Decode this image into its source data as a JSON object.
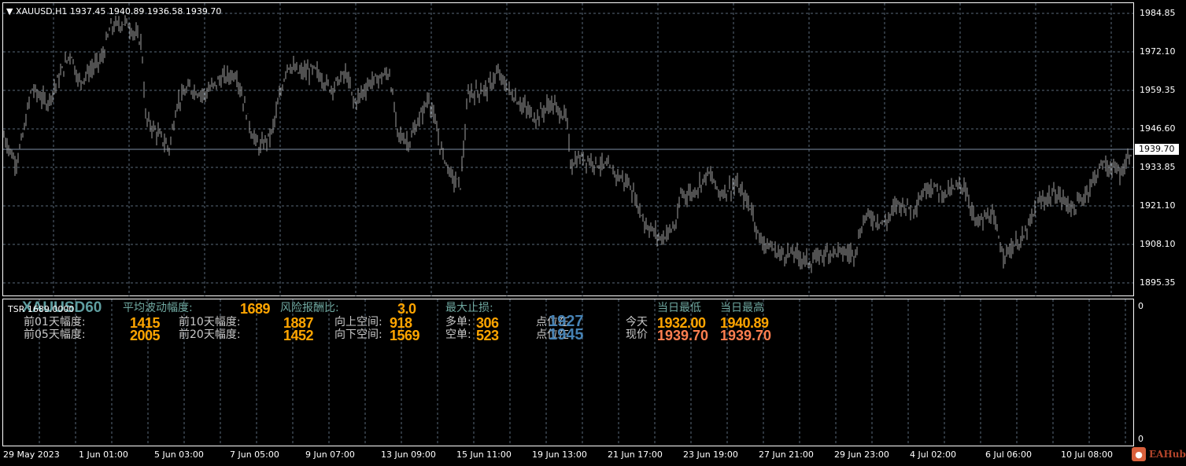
{
  "header": {
    "symbol": "XAUUSD,H1",
    "open": "1937.45",
    "high": "1940.89",
    "low": "1936.58",
    "close": "1939.70"
  },
  "price_axis": [
    "1984.85",
    "1972.10",
    "1959.35",
    "1946.60",
    "1933.85",
    "1921.10",
    "1908.10",
    "1895.35"
  ],
  "current_price": "1939.70",
  "time_axis": [
    "29 May 2023",
    "1 Jun 01:00",
    "5 Jun 03:00",
    "7 Jun 05:00",
    "9 Jun 07:00",
    "13 Jun 09:00",
    "15 Jun 11:00",
    "19 Jun 13:00",
    "21 Jun 17:00",
    "23 Jun 19:00",
    "27 Jun 21:00",
    "29 Jun 23:00",
    "4 Jul 02:00",
    "6 Jul 06:00",
    "10 Jul 08:00"
  ],
  "indicator": {
    "name": "TSR 1689.0000",
    "symbol_tag": "XAUUSD60",
    "axis_top": "0",
    "axis_bottom": "0",
    "avg_range_label": "平均波动幅度:",
    "avg_range": "1689",
    "rr_label": "风险报酬比:",
    "rr": "3.0",
    "max_sl_label": "最大止损:",
    "d1_label": "前01天幅度:",
    "d1": "1415",
    "d5_label": "前05天幅度:",
    "d5": "2005",
    "d10_label": "前10天幅度:",
    "d10": "1887",
    "d20_label": "前20天幅度:",
    "d20": "1452",
    "up_label": "向上空间:",
    "up": "918",
    "down_label": "向下空间:",
    "down": "1569",
    "long_label": "多单:",
    "long": "306",
    "short_label": "空单:",
    "short": "523",
    "pos1_label": "点位在",
    "pos1": "1927",
    "pos2_label": "点位在",
    "pos2": "1945",
    "low_header": "当日最低",
    "high_header": "当日最高",
    "today_label": "今天",
    "today_low": "1932.00",
    "today_high": "1940.89",
    "now_label": "现价",
    "now_low": "1939.70",
    "now_high": "1939.70"
  },
  "branding": {
    "text": "EAHub"
  },
  "colors": {
    "bars": "#a0a0a0",
    "grid": "#5a6a7a",
    "current_line": "#7f8fa6",
    "orange": "#ffa500",
    "coral": "#ff7f50",
    "steel": "#4682b4"
  }
}
